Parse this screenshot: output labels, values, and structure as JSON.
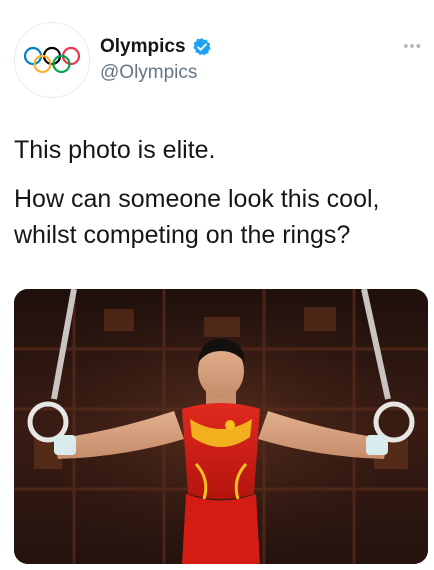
{
  "tweet": {
    "display_name": "Olympics",
    "handle": "@Olympics",
    "verified": true,
    "more_label": "•••",
    "text_line1": "This photo is elite.",
    "text_line2": "How can someone look this cool, whilst competing on the rings?"
  },
  "icons": {
    "avatar": "olympic-rings-logo",
    "verified": "verified-badge-icon",
    "more": "more-options-icon"
  },
  "colors": {
    "verified_blue": "#1da1f2",
    "text": "#14171a",
    "secondary_text": "#657786",
    "ring_blue": "#0081c8",
    "ring_yellow": "#fcb131",
    "ring_black": "#000000",
    "ring_green": "#00a651",
    "ring_red": "#ee334e"
  }
}
